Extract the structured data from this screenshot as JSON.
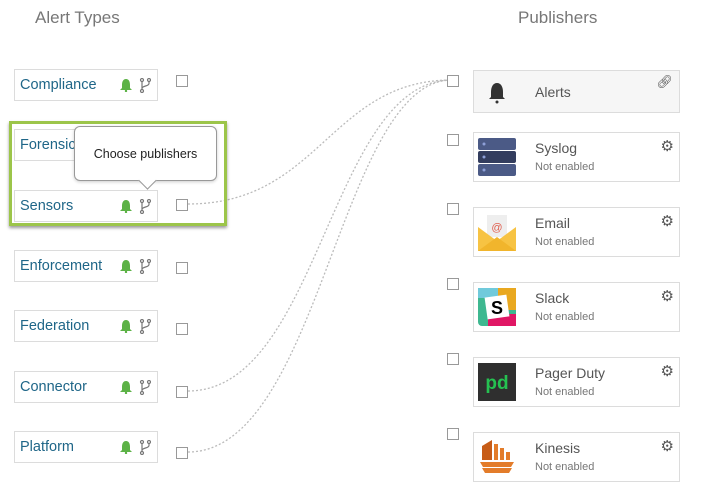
{
  "headers": {
    "alert_types": "Alert Types",
    "publishers": "Publishers"
  },
  "alert_types": [
    {
      "label": "Compliance"
    },
    {
      "label": "Forensics"
    },
    {
      "label": "Sensors"
    },
    {
      "label": "Enforcement"
    },
    {
      "label": "Federation"
    },
    {
      "label": "Connector"
    },
    {
      "label": "Platform"
    }
  ],
  "tooltip": "Choose publishers",
  "publishers": {
    "alerts": {
      "name": "Alerts"
    },
    "items": [
      {
        "name": "Syslog",
        "status": "Not enabled"
      },
      {
        "name": "Email",
        "status": "Not enabled"
      },
      {
        "name": "Slack",
        "status": "Not enabled"
      },
      {
        "name": "Pager Duty",
        "status": "Not enabled"
      },
      {
        "name": "Kinesis",
        "status": "Not enabled"
      }
    ]
  },
  "colors": {
    "highlight": "#9cc54a",
    "bell": "#5cb246",
    "link": "#1f6688"
  }
}
